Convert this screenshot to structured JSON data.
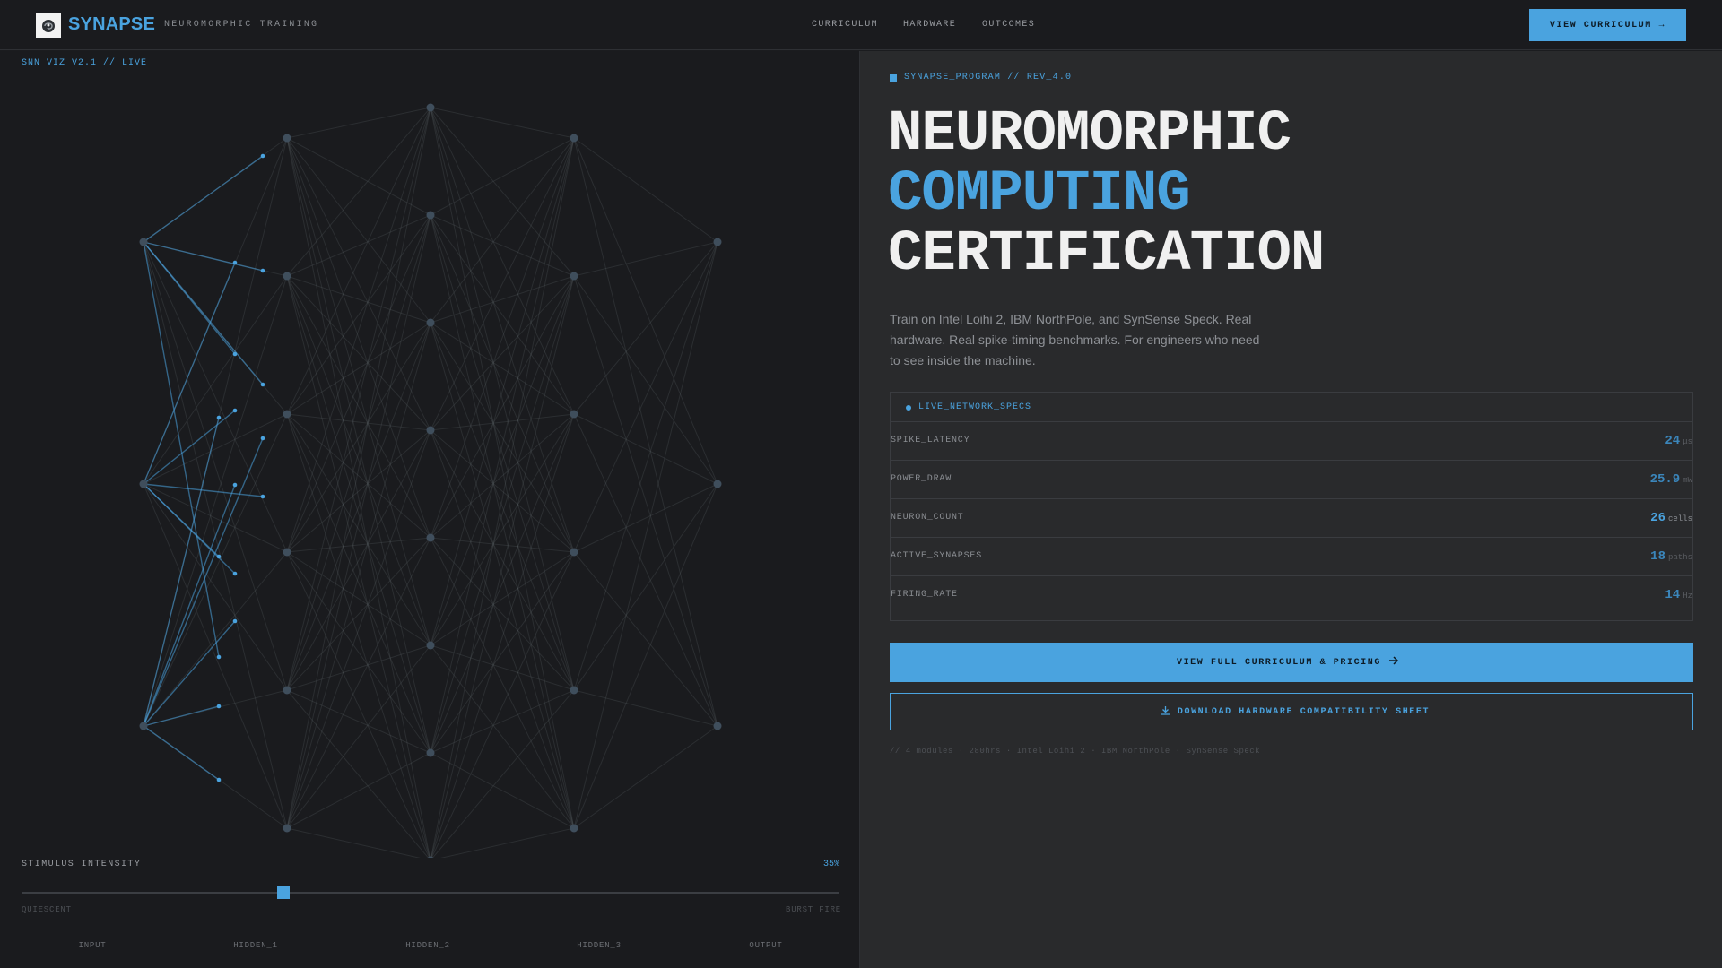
{
  "header": {
    "brand": "SYNAPSE",
    "tagline": "NEUROMORPHIC TRAINING",
    "logo_icon": "brain-icon",
    "nav": [
      {
        "label": "CURRICULUM"
      },
      {
        "label": "HARDWARE"
      },
      {
        "label": "OUTCOMES"
      }
    ],
    "cta_label": "VIEW CURRICULUM →"
  },
  "viz": {
    "label": "SNN_VIZ_V2.1 // LIVE",
    "stimulus": {
      "label": "STIMULUS INTENSITY",
      "value_text": "35%",
      "value": 0.32,
      "min_label": "QUIESCENT",
      "max_label": "BURST_FIRE"
    },
    "layers": [
      "INPUT",
      "HIDDEN_1",
      "HIDDEN_2",
      "HIDDEN_3",
      "OUTPUT"
    ]
  },
  "hero": {
    "eyebrow": "SYNAPSE_PROGRAM // REV_4.0",
    "title_line1": "NEUROMORPHIC",
    "title_line2": "COMPUTING",
    "title_line3": "CERTIFICATION",
    "description": "Train on Intel Loihi 2, IBM NorthPole, and SynSense Speck. Real hardware. Real spike-timing benchmarks. For engineers who need to see inside the machine."
  },
  "specs": {
    "title": "LIVE_NETWORK_SPECS",
    "rows": [
      {
        "name": "SPIKE_LATENCY",
        "value": "24",
        "unit": "μs"
      },
      {
        "name": "POWER_DRAW",
        "value": "25.9",
        "unit": "mW"
      },
      {
        "name": "NEURON_COUNT",
        "value": "26",
        "unit": "cells"
      },
      {
        "name": "ACTIVE_SYNAPSES",
        "value": "18",
        "unit": "paths"
      },
      {
        "name": "FIRING_RATE",
        "value": "14",
        "unit": "Hz"
      }
    ]
  },
  "actions": {
    "primary_label": "VIEW FULL CURRICULUM & PRICING",
    "primary_icon": "arrow-right-icon",
    "secondary_label": "DOWNLOAD HARDWARE COMPATIBILITY SHEET",
    "secondary_icon": "download-icon"
  },
  "footnote": "// 4 modules · 280hrs · Intel Loihi 2 · IBM NorthPole · SynSense Speck",
  "colors": {
    "accent": "#4aa3df",
    "background_left": "#1a1b1e",
    "background_right": "#292a2c"
  }
}
